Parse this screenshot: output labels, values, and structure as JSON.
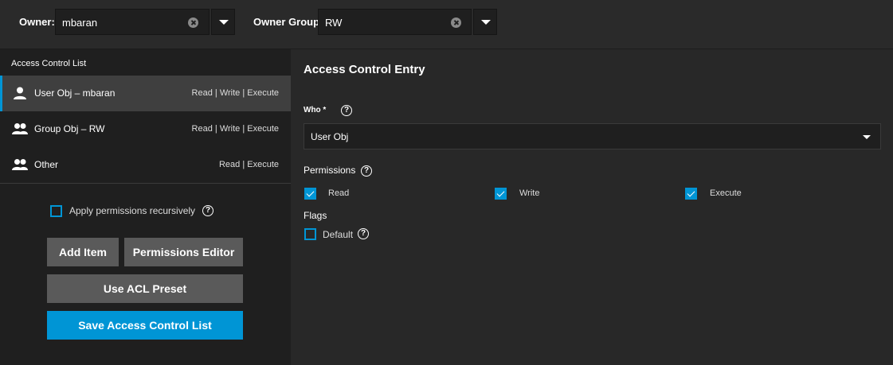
{
  "owner": {
    "label": "Owner:",
    "value": "mbaran"
  },
  "owner_group": {
    "label": "Owner Group:",
    "value": "RW"
  },
  "acl": {
    "title": "Access Control List",
    "items": [
      {
        "name": "User Obj – mbaran",
        "perms": "Read | Write | Execute",
        "icon": "user-icon",
        "active": true
      },
      {
        "name": "Group Obj – RW",
        "perms": "Read | Write | Execute",
        "icon": "group-icon",
        "active": false
      },
      {
        "name": "Other",
        "perms": "Read | Execute",
        "icon": "group-icon",
        "active": false
      }
    ],
    "recursive_label": "Apply permissions recursively",
    "recursive_checked": false
  },
  "buttons": {
    "add_item": "Add Item",
    "permissions_editor": "Permissions Editor",
    "use_acl_preset": "Use ACL Preset",
    "save_acl": "Save Access Control List"
  },
  "entry": {
    "title": "Access Control Entry",
    "who_label": "Who *",
    "who_value": "User Obj",
    "permissions_label": "Permissions",
    "permissions": [
      {
        "label": "Read",
        "checked": true
      },
      {
        "label": "Write",
        "checked": true
      },
      {
        "label": "Execute",
        "checked": true
      }
    ],
    "flags_label": "Flags",
    "flags": [
      {
        "label": "Default",
        "checked": false
      }
    ]
  },
  "colors": {
    "accent": "#0095d5",
    "panel": "#1f1f1f",
    "background": "#282828",
    "button": "#5a5a5a"
  }
}
